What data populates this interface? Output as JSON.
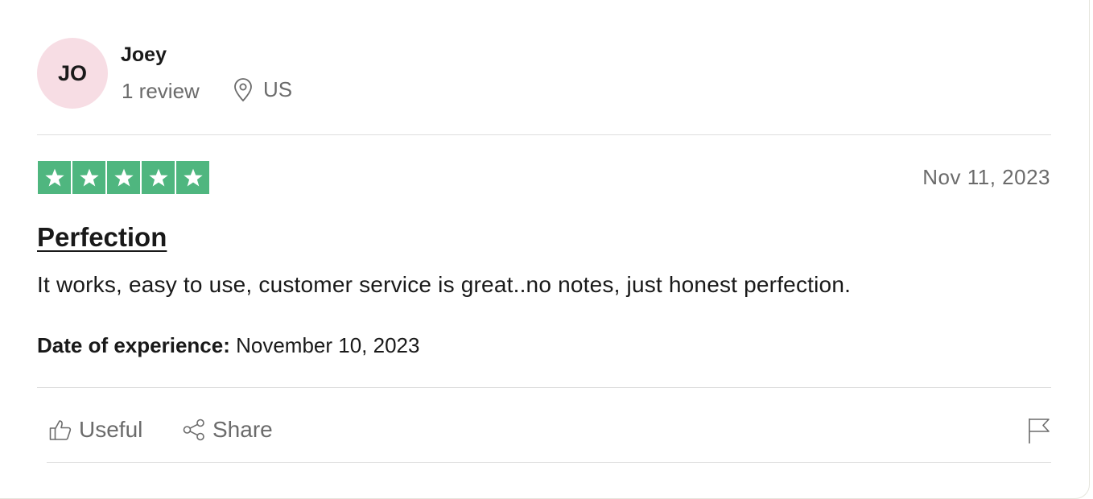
{
  "reviewer": {
    "initials": "JO",
    "name": "Joey",
    "review_count": "1 review",
    "country": "US"
  },
  "review": {
    "rating": 5,
    "rating_max": 5,
    "star_color": "#4fb67f",
    "date": "Nov 11, 2023",
    "title": "Perfection",
    "body": "It works, easy to use, customer service is great..no notes, just honest perfection.",
    "experience_label": "Date of experience:",
    "experience_date": "November 10, 2023"
  },
  "actions": {
    "useful_label": "Useful",
    "share_label": "Share"
  },
  "icons": {
    "location": "location-pin-icon",
    "useful": "thumbs-up-icon",
    "share": "share-icon",
    "report": "flag-icon"
  }
}
